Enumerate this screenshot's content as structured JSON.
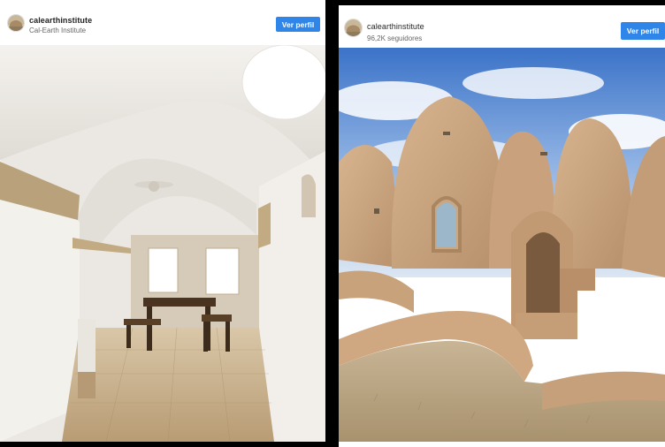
{
  "left_post": {
    "username": "calearthinstitute",
    "subtitle": "Cal-Earth Institute",
    "follow_label": "Ver perfil",
    "image_icon": "interior-vaulted-room-photo"
  },
  "right_post": {
    "username": "calearthinstitute",
    "subtitle": "96,2K seguidores",
    "follow_label": "Ver perfil",
    "image_icon": "superadobe-domes-photo"
  },
  "colors": {
    "button_blue": "#2f86e8",
    "background": "#000000"
  }
}
